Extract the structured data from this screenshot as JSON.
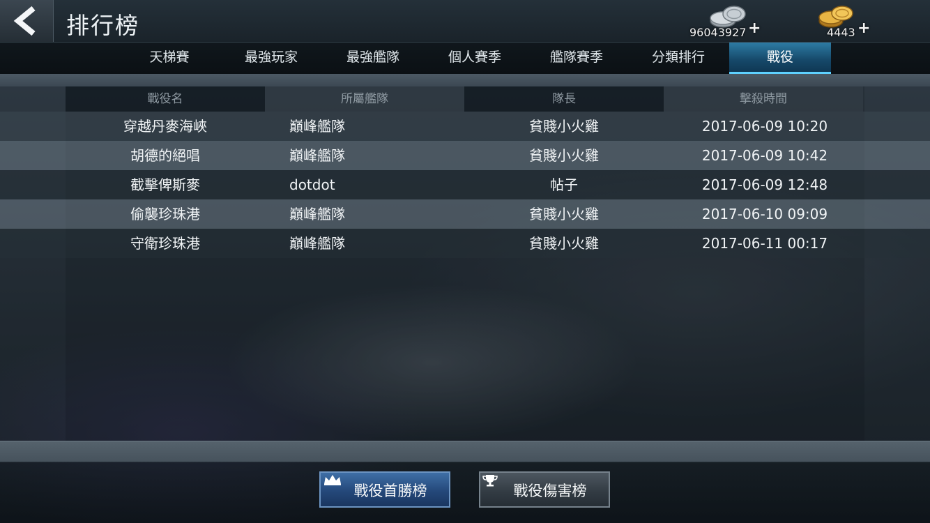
{
  "header": {
    "title": "排行榜",
    "back_icon": "back-arrow-icon"
  },
  "currency": {
    "silver": {
      "amount": "96043927",
      "icon": "silver-coins-icon",
      "plus": "+"
    },
    "gold": {
      "amount": "4443",
      "icon": "gold-coins-icon",
      "plus": "+"
    }
  },
  "tabs": [
    {
      "label": "天梯賽"
    },
    {
      "label": "最強玩家"
    },
    {
      "label": "最強艦隊"
    },
    {
      "label": "個人賽季"
    },
    {
      "label": "艦隊賽季"
    },
    {
      "label": "分類排行"
    },
    {
      "label": "戰役",
      "active": true
    }
  ],
  "table": {
    "columns": [
      "戰役名",
      "所屬艦隊",
      "隊長",
      "擊殺時間"
    ],
    "rows": [
      {
        "name": "穿越丹麥海峽",
        "fleet": "巔峰艦隊",
        "captain": "貧賤小火雞",
        "time": "2017-06-09 10:20"
      },
      {
        "name": "胡德的絕唱",
        "fleet": "巔峰艦隊",
        "captain": "貧賤小火雞",
        "time": "2017-06-09 10:42"
      },
      {
        "name": "截擊俾斯麥",
        "fleet": "dotdot",
        "captain": "帖子",
        "time": "2017-06-09 12:48"
      },
      {
        "name": "偷襲珍珠港",
        "fleet": "巔峰艦隊",
        "captain": "貧賤小火雞",
        "time": "2017-06-10 09:09"
      },
      {
        "name": "守衛珍珠港",
        "fleet": "巔峰艦隊",
        "captain": "貧賤小火雞",
        "time": "2017-06-11 00:17"
      }
    ]
  },
  "buttons": {
    "first_win": {
      "label": "戰役首勝榜",
      "icon": "crown-icon"
    },
    "damage": {
      "label": "戰役傷害榜",
      "icon": "trophy-icon"
    }
  },
  "colors": {
    "active_tab": "#2d7ba4",
    "active_tab_glow": "#5fd1ff",
    "primary_button": "#24487a"
  }
}
